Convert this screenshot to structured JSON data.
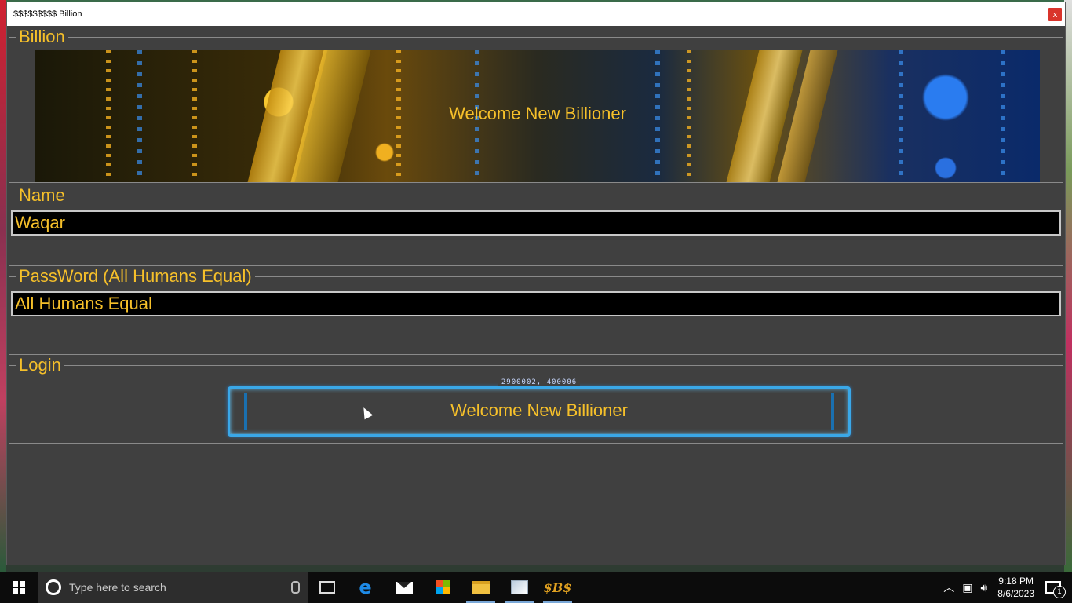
{
  "window": {
    "title": "$$$$$$$$$ Billion",
    "close_label": "x"
  },
  "groups": {
    "billion": {
      "legend": "Billion",
      "banner_text": "Welcome New Billioner"
    },
    "name": {
      "legend": "Name",
      "value": "Waqar"
    },
    "password": {
      "legend": "PassWord (All Humans Equal)",
      "value": "All Humans Equal"
    },
    "login": {
      "legend": "Login",
      "button_label": "Welcome New Billioner",
      "button_code": "2900002, 400006"
    }
  },
  "taskbar": {
    "search_placeholder": "Type here to search",
    "clock_time": "9:18 PM",
    "clock_date": "8/6/2023",
    "notification_count": "1",
    "pinned": [
      "task-view",
      "edge",
      "mail",
      "store",
      "file-explorer",
      "app",
      "billion-app"
    ],
    "billion_icon_text": "$B$"
  },
  "colors": {
    "accent_gold": "#f6c02a",
    "window_bg": "#404040",
    "frame_blue": "#3aa8e8"
  }
}
